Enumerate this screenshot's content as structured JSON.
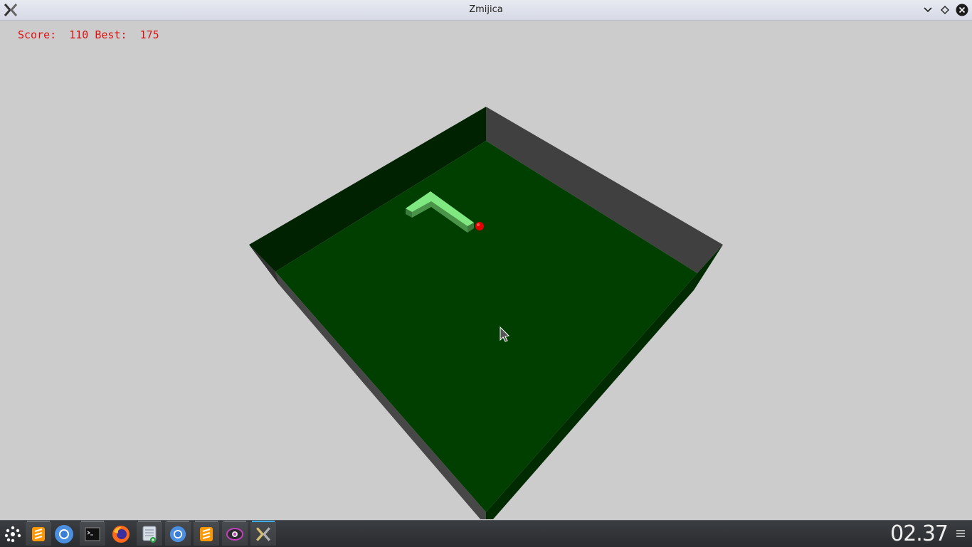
{
  "window": {
    "title": "Zmijica",
    "app_icon": "x-app-icon",
    "buttons": [
      "minimize-button",
      "maximize-button",
      "close-button"
    ]
  },
  "hud": {
    "score_label": "Score:",
    "score_value": "110",
    "best_label": "Best:",
    "best_value": "175"
  },
  "game": {
    "floor_color": "#003f00",
    "snake_color": "#80e880",
    "food_color": "#e00000"
  },
  "taskbar": {
    "launcher_icon": "app-launcher-icon",
    "apps": [
      {
        "icon": "sublime-text-icon",
        "active": true
      },
      {
        "icon": "chromium-icon",
        "active": false
      },
      {
        "icon": "terminal-icon",
        "active": true
      },
      {
        "icon": "firefox-icon",
        "active": false
      },
      {
        "icon": "file-manager-icon",
        "active": true
      },
      {
        "icon": "chromium-icon",
        "active": true
      },
      {
        "icon": "sublime-text-icon",
        "active": true
      },
      {
        "icon": "eye-app-icon",
        "active": true
      },
      {
        "icon": "x-app-icon",
        "active": true
      }
    ],
    "clock": "02.37",
    "menu_icon": "hamburger-menu-icon"
  }
}
